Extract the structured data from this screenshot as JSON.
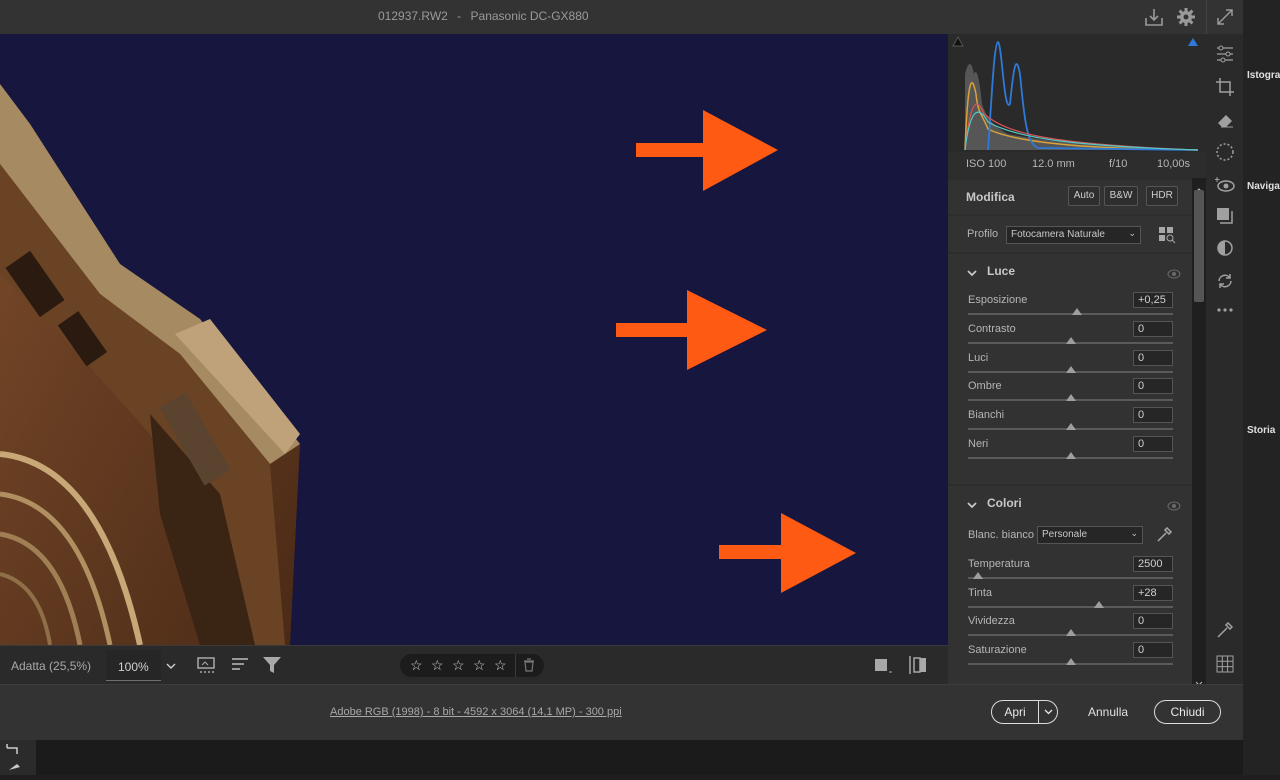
{
  "title_bar": {
    "filename": "012937.RW2",
    "separator": "-",
    "camera": "Panasonic DC-GX880",
    "icons": [
      "download-icon",
      "settings-gear-icon",
      "expand-icon"
    ]
  },
  "histogram": {
    "exif": {
      "iso": "ISO 100",
      "focal": "12.0 mm",
      "aperture": "f/10",
      "shutter": "10,00s"
    }
  },
  "modifica": {
    "title": "Modifica",
    "buttons": {
      "auto": "Auto",
      "bw": "B&W",
      "hdr": "HDR"
    },
    "profile_label": "Profilo",
    "profile_value": "Fotocamera Naturale"
  },
  "luce": {
    "title": "Luce",
    "sliders": [
      {
        "label": "Esposizione",
        "value": "+0,25",
        "position": 0.53
      },
      {
        "label": "Contrasto",
        "value": "0",
        "position": 0.5
      },
      {
        "label": "Luci",
        "value": "0",
        "position": 0.5
      },
      {
        "label": "Ombre",
        "value": "0",
        "position": 0.5
      },
      {
        "label": "Bianchi",
        "value": "0",
        "position": 0.5
      },
      {
        "label": "Neri",
        "value": "0",
        "position": 0.5
      }
    ]
  },
  "colori": {
    "title": "Colori",
    "wb_label": "Blanc. bianco",
    "wb_value": "Personale",
    "sliders": [
      {
        "label": "Temperatura",
        "value": "2500",
        "position": 0.05
      },
      {
        "label": "Tinta",
        "value": "+28",
        "position": 0.64
      },
      {
        "label": "Vividezza",
        "value": "0",
        "position": 0.5
      },
      {
        "label": "Saturazione",
        "value": "0",
        "position": 0.5
      }
    ]
  },
  "photo_toolbar": {
    "fit_label": "Adatta (25,5%)",
    "zoom_value": "100%",
    "rating_stars": 0
  },
  "footer": {
    "info": "Adobe RGB (1998) - 8 bit - 4592 x 3064 (14,1 MP) - 300 ppi",
    "open": "Apri",
    "cancel": "Annulla",
    "close": "Chiudi"
  },
  "background_app": {
    "istogramma": "Istogramma",
    "navigatore": "Navigatore",
    "storia": "Storia"
  },
  "colors": {
    "arrow": "#ff5a14",
    "sky": "#16163f",
    "accent_blue": "#2f7ad8"
  }
}
